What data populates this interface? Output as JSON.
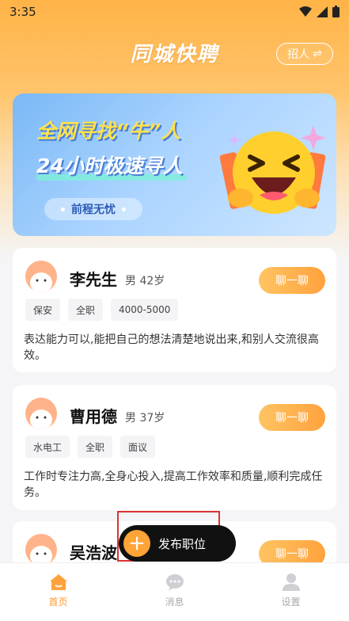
{
  "status": {
    "time": "3:35"
  },
  "header": {
    "title": "同城快聘",
    "recruit_label": "招人"
  },
  "banner": {
    "line1": "全网寻找“牛”人",
    "line2": "24小时极速寻人",
    "pill": "前程无忧"
  },
  "candidates": [
    {
      "name": "李先生",
      "meta": "男 42岁",
      "chat_label": "聊一聊",
      "tags": [
        "保安",
        "全职",
        "4000-5000"
      ],
      "desc": "表达能力可以,能把自己的想法清楚地说出来,和别人交流很高效。"
    },
    {
      "name": "曹用德",
      "meta": "男 37岁",
      "chat_label": "聊一聊",
      "tags": [
        "水电工",
        "全职",
        "面议"
      ],
      "desc": "工作时专注力高,全身心投入,提高工作效率和质量,顺利完成任务。"
    },
    {
      "name": "吴浩波",
      "meta": "",
      "chat_label": "聊一聊",
      "tags": [],
      "desc": ""
    }
  ],
  "fab": {
    "label": "发布职位"
  },
  "tabbar": {
    "items": [
      {
        "label": "首页",
        "icon": "home-icon",
        "active": true
      },
      {
        "label": "消息",
        "icon": "message-icon",
        "active": false
      },
      {
        "label": "设置",
        "icon": "profile-icon",
        "active": false
      }
    ]
  },
  "colors": {
    "accent": "#ffa23d",
    "banner": "#a9d3ff"
  }
}
